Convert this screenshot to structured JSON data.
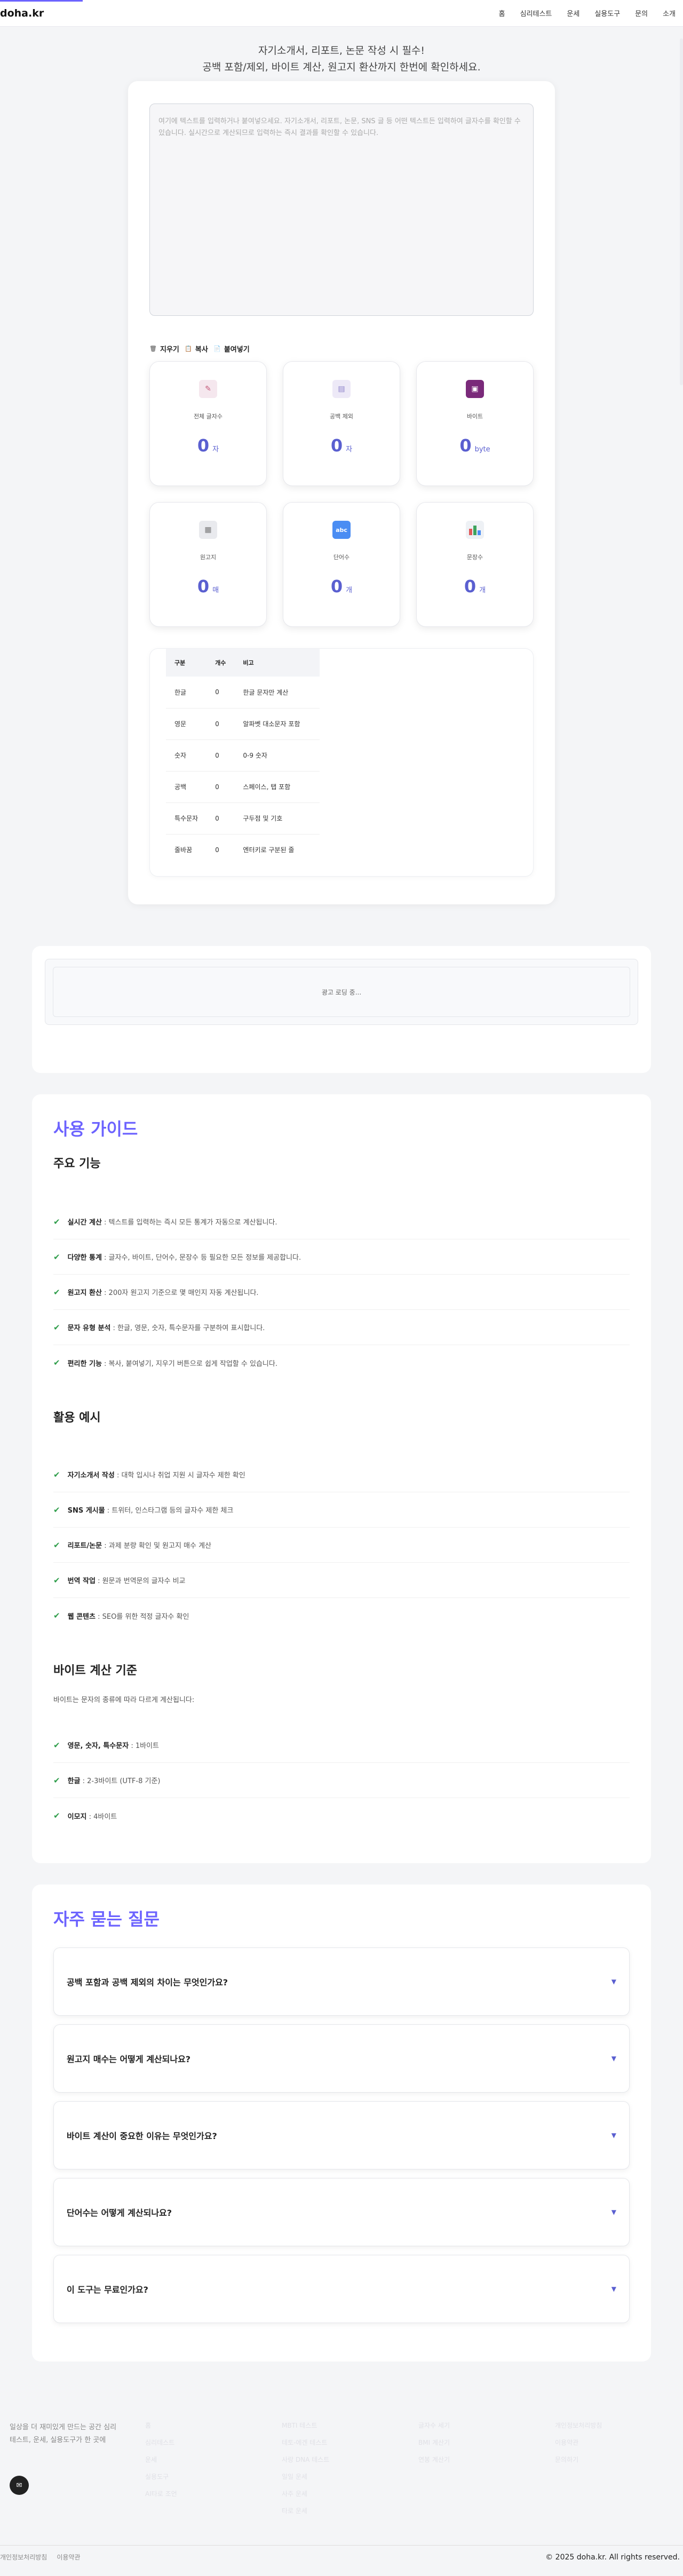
{
  "site": {
    "logo": "doha.kr"
  },
  "nav": [
    "홈",
    "심리테스트",
    "운세",
    "실용도구",
    "문의",
    "소개"
  ],
  "intro": {
    "line1": "자기소개서, 리포트, 논문 작성 시 필수!",
    "line2": "공백 포함/제외, 바이트 계산, 원고지 환산까지 한번에 확인하세요."
  },
  "editor": {
    "placeholder": "여기에 텍스트를 입력하거나 붙여넣으세요. 자기소개서, 리포트, 논문, SNS 글 등 어떤 텍스트든 입력하여 글자수를 확인할 수 있습니다. 실시간으로 계산되므로 입력하는 즉시 결과를 확인할 수 있습니다."
  },
  "actions": {
    "clear": "지우기",
    "copy": "복사",
    "paste": "붙여넣기"
  },
  "stats": [
    {
      "label": "전체 글자수",
      "value": "0",
      "unit": "자",
      "icon": "document-pencil-icon",
      "color": "#f5e7ee"
    },
    {
      "label": "공백 제외",
      "value": "0",
      "unit": "자",
      "icon": "document-icon",
      "color": "#ede9f7"
    },
    {
      "label": "바이트",
      "value": "0",
      "unit": "byte",
      "icon": "floppy-disk-icon",
      "color": "#7a2a7a"
    },
    {
      "label": "원고지",
      "value": "0",
      "unit": "매",
      "icon": "newspaper-icon",
      "color": "#e9eaee"
    },
    {
      "label": "단어수",
      "value": "0",
      "unit": "개",
      "icon": "abc-icon",
      "color": "#4a8df3"
    },
    {
      "label": "문장수",
      "value": "0",
      "unit": "개",
      "icon": "bar-chart-icon",
      "color": "#eef1f5"
    }
  ],
  "breakdown": {
    "headers": [
      "구분",
      "개수",
      "비고"
    ],
    "rows": [
      [
        "한글",
        "0",
        "한글 문자만 계산"
      ],
      [
        "영문",
        "0",
        "알파벳 대소문자 포함"
      ],
      [
        "숫자",
        "0",
        "0-9 숫자"
      ],
      [
        "공백",
        "0",
        "스페이스, 탭 포함"
      ],
      [
        "특수문자",
        "0",
        "구두점 및 기호"
      ],
      [
        "줄바꿈",
        "0",
        "엔터키로 구분된 줄"
      ]
    ]
  },
  "ad": {
    "loading": "광고 로딩 중..."
  },
  "guide": {
    "title": "사용 가이드",
    "features_title": "주요 기능",
    "features": [
      {
        "strong": "실시간 계산",
        "text": " : 텍스트를 입력하는 즉시 모든 통계가 자동으로 계산됩니다."
      },
      {
        "strong": "다양한 통계",
        "text": " : 글자수, 바이트, 단어수, 문장수 등 필요한 모든 정보를 제공합니다."
      },
      {
        "strong": "원고지 환산",
        "text": " : 200자 원고지 기준으로 몇 매인지 자동 계산됩니다."
      },
      {
        "strong": "문자 유형 분석",
        "text": " : 한글, 영문, 숫자, 특수문자를 구분하여 표시합니다."
      },
      {
        "strong": "편리한 기능",
        "text": " : 복사, 붙여넣기, 지우기 버튼으로 쉽게 작업할 수 있습니다."
      }
    ],
    "examples_title": "활용 예시",
    "examples": [
      {
        "strong": "자기소개서 작성",
        "text": " : 대학 입시나 취업 지원 시 글자수 제한 확인"
      },
      {
        "strong": "SNS 게시물",
        "text": " : 트위터, 인스타그램 등의 글자수 제한 체크"
      },
      {
        "strong": "리포트/논문",
        "text": " : 과제 분량 확인 및 원고지 매수 계산"
      },
      {
        "strong": "번역 작업",
        "text": " : 원문과 번역문의 글자수 비교"
      },
      {
        "strong": "웹 콘텐츠",
        "text": " : SEO를 위한 적정 글자수 확인"
      }
    ],
    "byte_title": "바이트 계산 기준",
    "byte_desc": "바이트는 문자의 종류에 따라 다르게 계산됩니다:",
    "byte_items": [
      {
        "strong": "영문, 숫자, 특수문자",
        "text": " : 1바이트"
      },
      {
        "strong": "한글",
        "text": " : 2-3바이트 (UTF-8 기준)"
      },
      {
        "strong": "이모지",
        "text": " : 4바이트"
      }
    ]
  },
  "faq": {
    "title": "자주 묻는 질문",
    "items": [
      "공백 포함과 공백 제외의 차이는 무엇인가요?",
      "원고지 매수는 어떻게 계산되나요?",
      "바이트 계산이 중요한 이유는 무엇인가요?",
      "단어수는 어떻게 계산되나요?",
      "이 도구는 무료인가요?"
    ]
  },
  "footer": {
    "desc": "일상을 더 재미있게 만드는 공간 심리테스트, 운세, 실용도구가 한 곳에",
    "cols": [
      [
        "홈",
        "심리테스트",
        "운세",
        "실용도구",
        "AI타로 조언"
      ],
      [
        "MBTI 테스트",
        "테토-에겐 테스트",
        "사랑 DNA 테스트",
        "일일 운세",
        "사주 운세",
        "타로 운세"
      ],
      [
        "글자수 세기",
        "BMI 계산기",
        "연봉 계산기"
      ],
      [
        "개인정보처리방침",
        "이용약관",
        "문의하기"
      ]
    ],
    "legal": [
      "개인정보처리방침",
      "이용약관"
    ],
    "copyright": "© 2025 doha.kr. All rights reserved."
  }
}
